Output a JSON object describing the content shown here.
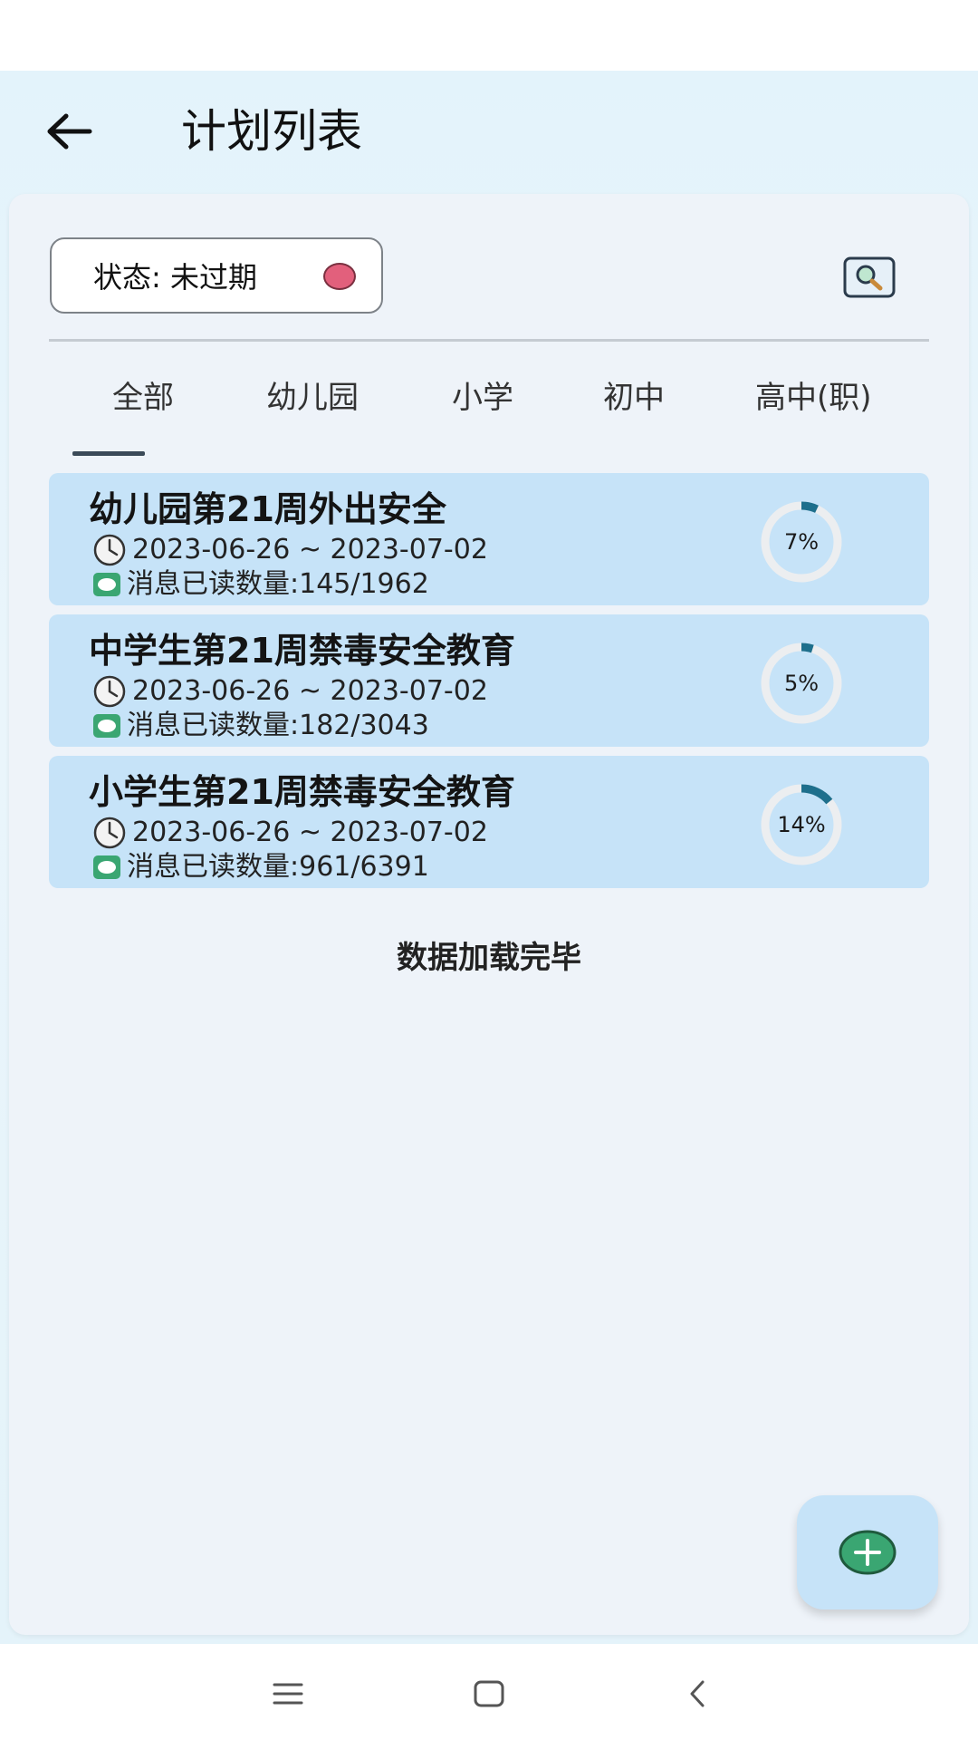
{
  "header": {
    "title": "计划列表"
  },
  "filter": {
    "status_label": "状态: 未过期"
  },
  "tabs": [
    {
      "label": "全部",
      "active": true
    },
    {
      "label": "幼儿园",
      "active": false
    },
    {
      "label": "小学",
      "active": false
    },
    {
      "label": "初中",
      "active": false
    },
    {
      "label": "高中(职)",
      "active": false
    }
  ],
  "plans": [
    {
      "title": "幼儿园第21周外出安全",
      "date_range": "2023-06-26 ~ 2023-07-02",
      "read_label": "消息已读数量:145/1962",
      "progress_text": "7%",
      "progress": 0.07
    },
    {
      "title": "中学生第21周禁毒安全教育",
      "date_range": "2023-06-26 ~ 2023-07-02",
      "read_label": "消息已读数量:182/3043",
      "progress_text": "5%",
      "progress": 0.05
    },
    {
      "title": "小学生第21周禁毒安全教育",
      "date_range": "2023-06-26 ~ 2023-07-02",
      "read_label": "消息已读数量:961/6391",
      "progress_text": "14%",
      "progress": 0.14
    }
  ],
  "list_footer": "数据加载完毕",
  "colors": {
    "accent_ring": "#1e6f8c",
    "ring_track": "#eceef0",
    "card_bg": "#c6e3f8",
    "status_dot": "#e2607c",
    "fab_plus": "#3aa672"
  },
  "icons": {
    "back": "arrow-left-icon",
    "search": "magnifier-icon",
    "date": "clock-icon",
    "messages": "message-icon",
    "add": "plus-icon"
  }
}
